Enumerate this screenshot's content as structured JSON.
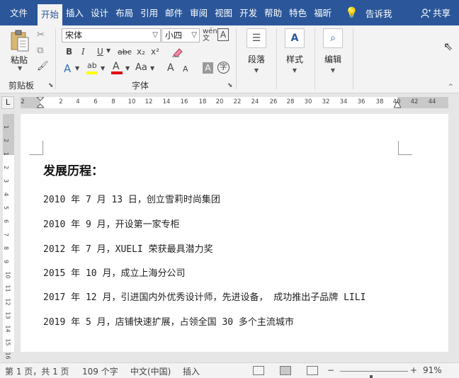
{
  "tabs": [
    "文件",
    "开始",
    "插入",
    "设计",
    "布局",
    "引用",
    "邮件",
    "审阅",
    "视图",
    "开发",
    "帮助",
    "特色",
    "福昕"
  ],
  "active_tab": "开始",
  "tell_me": "告诉我",
  "share": "共享",
  "clipboard": {
    "paste": "粘贴",
    "group_label": "剪贴板"
  },
  "font": {
    "name": "宋体",
    "size": "小四",
    "group_label": "字体",
    "buttons": [
      "B",
      "I",
      "U",
      "abc",
      "x₂",
      "x²"
    ],
    "row3": [
      "A",
      "A",
      "Aa",
      "A",
      "A"
    ]
  },
  "paragraph": {
    "label": "段落"
  },
  "styles": {
    "label": "样式"
  },
  "editing": {
    "label": "编辑"
  },
  "ruler": {
    "corner": "L",
    "ticks": [
      "2",
      "2",
      "4",
      "6",
      "8",
      "10",
      "12",
      "14",
      "16",
      "18",
      "20",
      "22",
      "24",
      "26",
      "28",
      "30",
      "32",
      "34",
      "36",
      "38",
      "40",
      "42",
      "44"
    ],
    "vticks": [
      "1",
      "2",
      "1",
      "2",
      "3",
      "4",
      "5",
      "6",
      "7",
      "8",
      "9",
      "10",
      "11",
      "12",
      "13",
      "14",
      "15",
      "16"
    ]
  },
  "document": {
    "title": "发展历程：",
    "lines": [
      "2010 年 7 月 13 日，创立雪莉时尚集团",
      "2010 年 9 月，开设第一家专柜",
      "2012 年 7 月，XUELI 荣获最具潜力奖",
      "2015 年 10 月，成立上海分公司",
      "2017 年 12 月，引进国内外优秀设计师，先进设备， 成功推出子品牌 LILI",
      "2019 年 5 月，店铺快速扩展，占领全国 30 多个主流城市"
    ]
  },
  "status": {
    "page": "第 1 页，共 1 页",
    "words": "109 个字",
    "lang": "中文(中国)",
    "mode": "插入",
    "zoom": "91%",
    "zoom_value": 0.91
  }
}
